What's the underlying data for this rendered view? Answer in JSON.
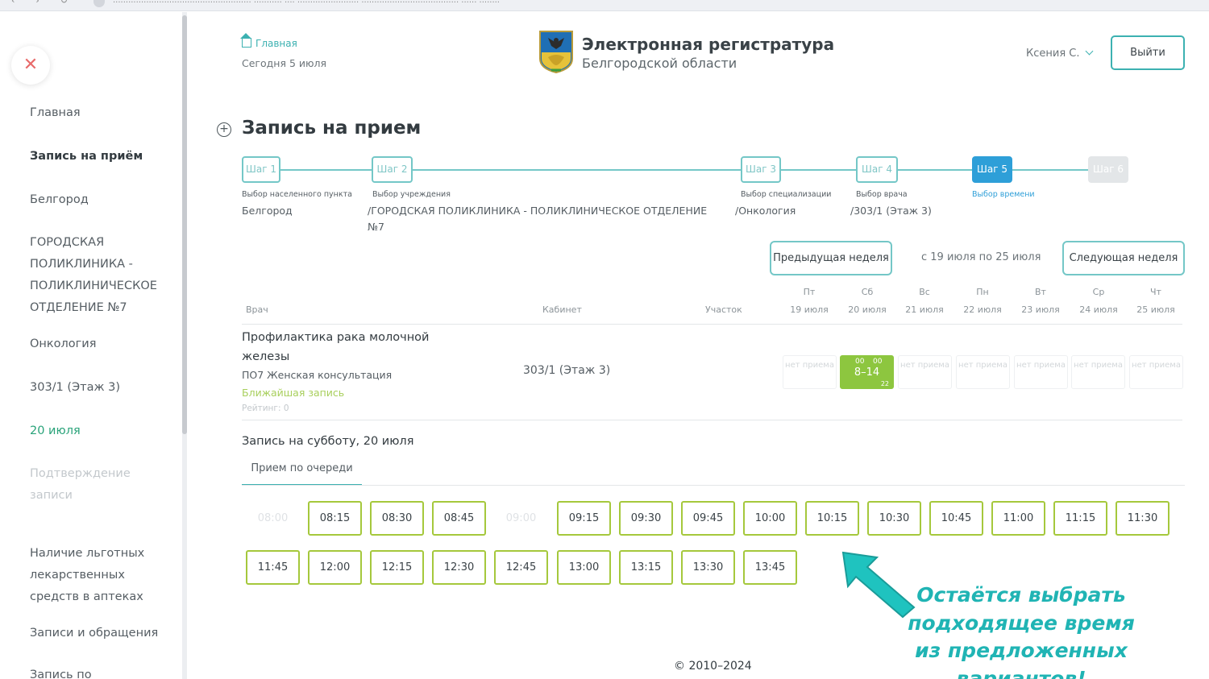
{
  "browser": {
    "url": "...................................................... ........... .... ........................ ...................................... ...... ........"
  },
  "sidebar": {
    "close_icon": "close-icon",
    "items": [
      {
        "label": "Главная"
      },
      {
        "label": "Запись на приём"
      },
      {
        "label": "Белгород"
      },
      {
        "label": "ГОРОДСКАЯ ПОЛИКЛИНИКА - ПОЛИКЛИНИЧЕСКОЕ ОТДЕЛЕНИЕ №7"
      },
      {
        "label": "Онкология"
      },
      {
        "label": "303/1 (Этаж 3)"
      },
      {
        "label": "20 июля"
      },
      {
        "label": "Подтверждение записи"
      },
      {
        "label": "Наличие льготных лекарственных средств в аптеках"
      },
      {
        "label": "Записи и обращения"
      },
      {
        "label": "Запись по"
      }
    ]
  },
  "header": {
    "breadcrumb": "Главная",
    "today": "Сегодня 5 июля",
    "title": "Электронная регистратура",
    "subtitle": "Белгородской области",
    "user": "Ксения С.",
    "logout": "Выйти"
  },
  "page": {
    "title": "Запись на прием"
  },
  "steps": [
    {
      "label": "Шаг 1",
      "caption": "Выбор населенного пункта",
      "value": "Белгород",
      "state": "done"
    },
    {
      "label": "Шаг 2",
      "caption": "Выбор учреждения",
      "value": "/ГОРОДСКАЯ ПОЛИКЛИНИКА - ПОЛИКЛИНИЧЕСКОЕ ОТДЕЛЕНИЕ №7",
      "state": "done"
    },
    {
      "label": "Шаг 3",
      "caption": "Выбор специализации",
      "value": "/Онкология",
      "state": "done"
    },
    {
      "label": "Шаг 4",
      "caption": "Выбор врача",
      "value": "/303/1 (Этаж 3)",
      "state": "done"
    },
    {
      "label": "Шаг 5",
      "caption": "Выбор времени",
      "value": "",
      "state": "active"
    },
    {
      "label": "Шаг 6",
      "caption": "",
      "value": "",
      "state": "disabled"
    }
  ],
  "week": {
    "prev": "Предыдущая неделя",
    "range": "с 19 июля по 25 июля",
    "next": "Следующая неделя"
  },
  "table": {
    "headers": {
      "doctor": "Врач",
      "cabinet": "Кабинет",
      "area": "Участок"
    },
    "days": [
      {
        "dow": "Пт",
        "date": "19 июля"
      },
      {
        "dow": "Сб",
        "date": "20 июля"
      },
      {
        "dow": "Вс",
        "date": "21 июля"
      },
      {
        "dow": "Пн",
        "date": "22 июля"
      },
      {
        "dow": "Вт",
        "date": "23 июля"
      },
      {
        "dow": "Ср",
        "date": "24 июля"
      },
      {
        "dow": "Чт",
        "date": "25 июля"
      }
    ],
    "row": {
      "name": "Профилактика рака молочной железы",
      "dept": "ПО7 Женская консультация",
      "nearest": "Ближайшая запись",
      "rating": "Рейтинг: 0",
      "cabinet": "303/1 (Этаж 3)",
      "no_reception": "нет приема",
      "available": {
        "range": "8–14",
        "sup_from": "00",
        "sup_to": "00",
        "count": "22"
      }
    }
  },
  "times": {
    "title": "Запись на субботу, 20 июля",
    "tab": "Прием по очереди",
    "slots": [
      {
        "t": "08:00",
        "on": false
      },
      {
        "t": "08:15",
        "on": true
      },
      {
        "t": "08:30",
        "on": true
      },
      {
        "t": "08:45",
        "on": true
      },
      {
        "t": "09:00",
        "on": false
      },
      {
        "t": "09:15",
        "on": true
      },
      {
        "t": "09:30",
        "on": true
      },
      {
        "t": "09:45",
        "on": true
      },
      {
        "t": "10:00",
        "on": true
      },
      {
        "t": "10:15",
        "on": true
      },
      {
        "t": "10:30",
        "on": true
      },
      {
        "t": "10:45",
        "on": true
      },
      {
        "t": "11:00",
        "on": true
      },
      {
        "t": "11:15",
        "on": true
      },
      {
        "t": "11:30",
        "on": true
      },
      {
        "t": "11:45",
        "on": true
      },
      {
        "t": "12:00",
        "on": true
      },
      {
        "t": "12:15",
        "on": true
      },
      {
        "t": "12:30",
        "on": true
      },
      {
        "t": "12:45",
        "on": true
      },
      {
        "t": "13:00",
        "on": true
      },
      {
        "t": "13:15",
        "on": true
      },
      {
        "t": "13:30",
        "on": true
      },
      {
        "t": "13:45",
        "on": true
      }
    ]
  },
  "annotation": "Остаётся выбрать подходящее время из предложенных вариантов!",
  "footer": "© 2010–2024",
  "colors": {
    "accent": "#3cb1b1",
    "step_active": "#2e9fd8",
    "slot_border": "#a5c83c",
    "available": "#8dc63f",
    "note": "#20b4b4"
  }
}
